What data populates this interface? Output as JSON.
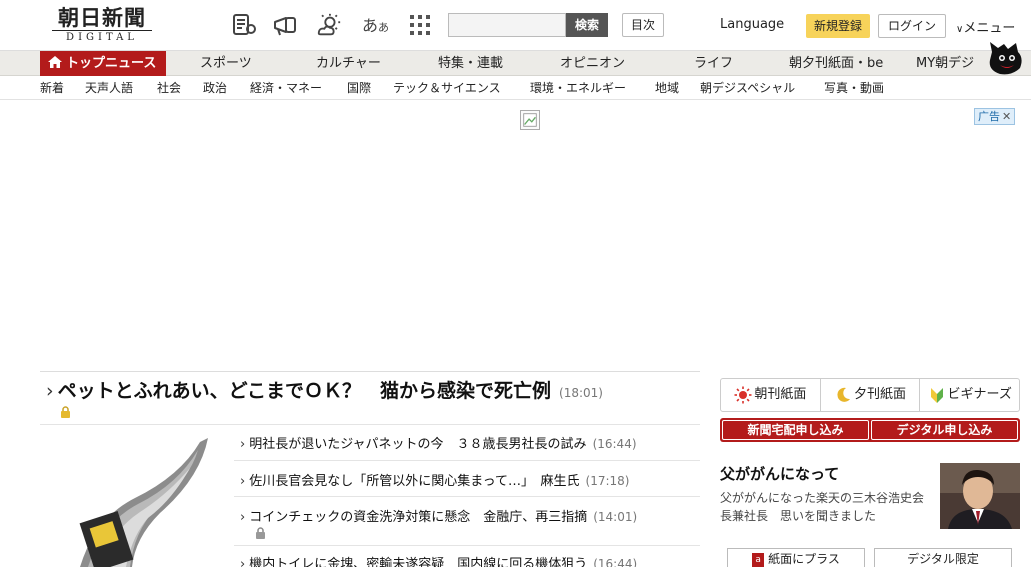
{
  "header": {
    "logo_jp": "朝日新聞",
    "logo_en": "DIGITAL",
    "search_button": "検索",
    "search_placeholder": "",
    "toc_button": "目次",
    "language": "Language",
    "signup": "新規登録",
    "login": "ログイン",
    "menu": "メニュー",
    "icons": [
      "article-list-icon",
      "megaphone-icon",
      "weather-icon",
      "font-size-icon",
      "grid-menu-icon"
    ]
  },
  "main_nav": {
    "items": [
      "トップニュース",
      "スポーツ",
      "カルチャー",
      "特集・連載",
      "オピニオン",
      "ライフ",
      "朝夕刊紙面・be",
      "MY朝デジ"
    ]
  },
  "sub_nav": {
    "items": [
      "新着",
      "天声人語",
      "社会",
      "政治",
      "経済・マネー",
      "国際",
      "テック＆サイエンス",
      "環境・エネルギー",
      "地域",
      "朝デジスペシャル",
      "写真・動画"
    ]
  },
  "ad": {
    "badge": "广告"
  },
  "headline": {
    "title": "ペットとふれあい、どこまでＯＫ？　猫から感染で死亡例",
    "time": "(18:01)"
  },
  "news": [
    {
      "title": "明社長が退いたジャパネットの今　３８歳長男社長の試み",
      "time": "(16:44)"
    },
    {
      "title": "佐川長官会見なし「所管以外に関心集まって…」　麻生氏",
      "time": "(17:18)"
    },
    {
      "title": "コインチェックの資金洗浄対策に懸念　金融庁、再三指摘",
      "time": "(14:01)"
    },
    {
      "title": "機内トイレに金塊、密輸未遂容疑　国内線に回る機体狙う",
      "time": "(16:44)"
    }
  ],
  "right": {
    "paper_tabs": [
      "朝刊紙面",
      "夕刊紙面",
      "ビギナーズ"
    ],
    "red_buttons": [
      "新聞宅配申し込み",
      "デジタル申し込み"
    ],
    "feature_title": "父ががんになって",
    "feature_text": "父ががんになった楽天の三木谷浩史会長兼社長　思いを聞きました",
    "bottom_buttons": [
      "紙面にプラス",
      "デジタル限定"
    ]
  },
  "colors": {
    "brand_red": "#b31b1b",
    "signup_yellow": "#f7d35a",
    "nav_bg": "#ecebe7"
  }
}
